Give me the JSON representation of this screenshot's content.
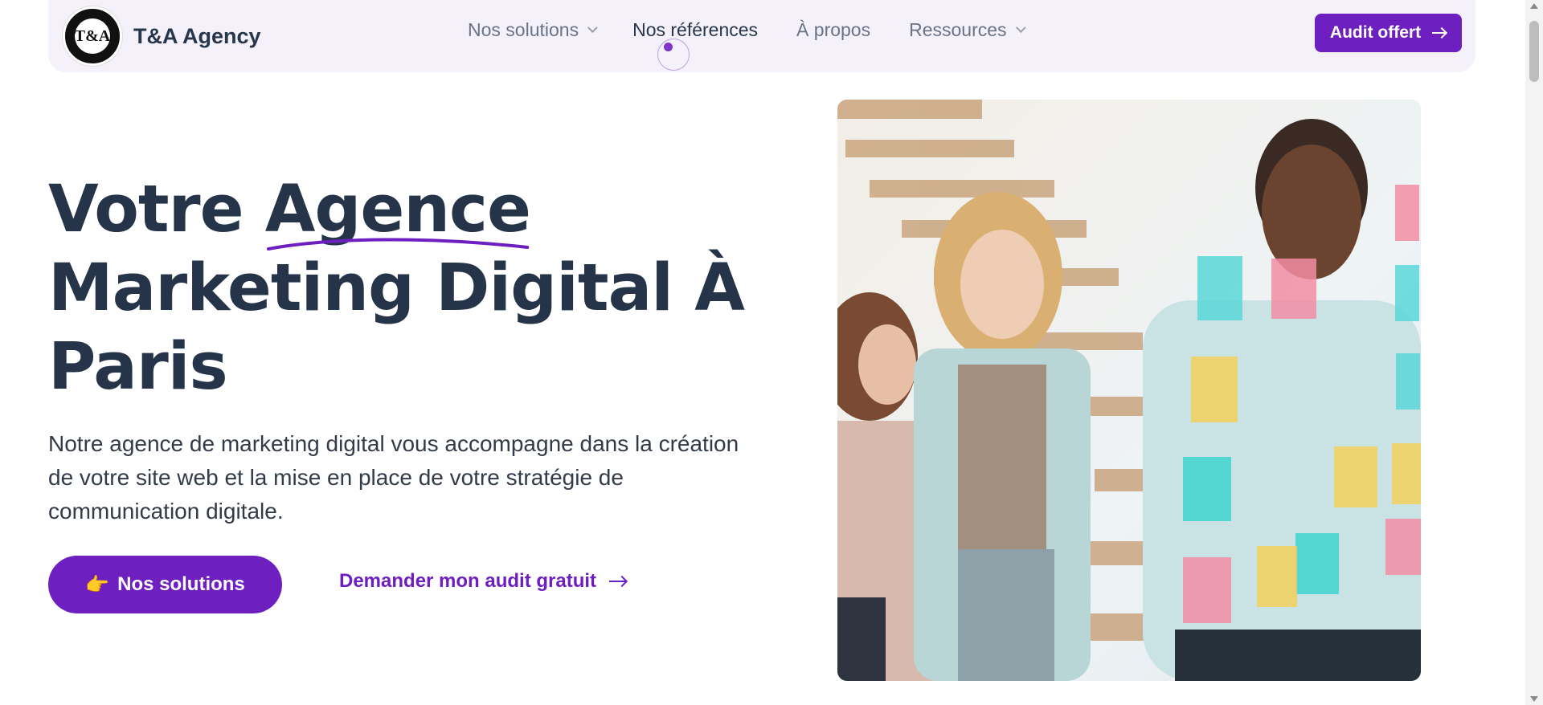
{
  "header": {
    "logo_text": "T&A",
    "brand_name": "T&A Agency",
    "menu": [
      {
        "label": "Nos solutions",
        "dropdown": true
      },
      {
        "label": "Nos références",
        "dropdown": false
      },
      {
        "label": "À propos",
        "dropdown": false
      },
      {
        "label": "Ressources",
        "dropdown": true
      }
    ],
    "cta_label": "Audit offert"
  },
  "hero": {
    "title_part1": "Votre ",
    "title_highlight": "Agence",
    "title_part2": "Marketing Digital À",
    "title_part3": "Paris",
    "description": "Notre agence de marketing digital vous accompagne dans la création de votre site web et la mise en place de votre stratégie de communication digitale.",
    "primary_button": "Nos solutions",
    "primary_button_icon": "👉",
    "secondary_link": "Demander mon audit gratuit"
  },
  "colors": {
    "accent": "#6d1fbf",
    "text_dark": "#26344a",
    "nav_bg": "#f5f1fa"
  },
  "icons": [
    "logo-icon",
    "chevron-down-icon",
    "arrow-right-icon",
    "pointing-hand-icon"
  ]
}
